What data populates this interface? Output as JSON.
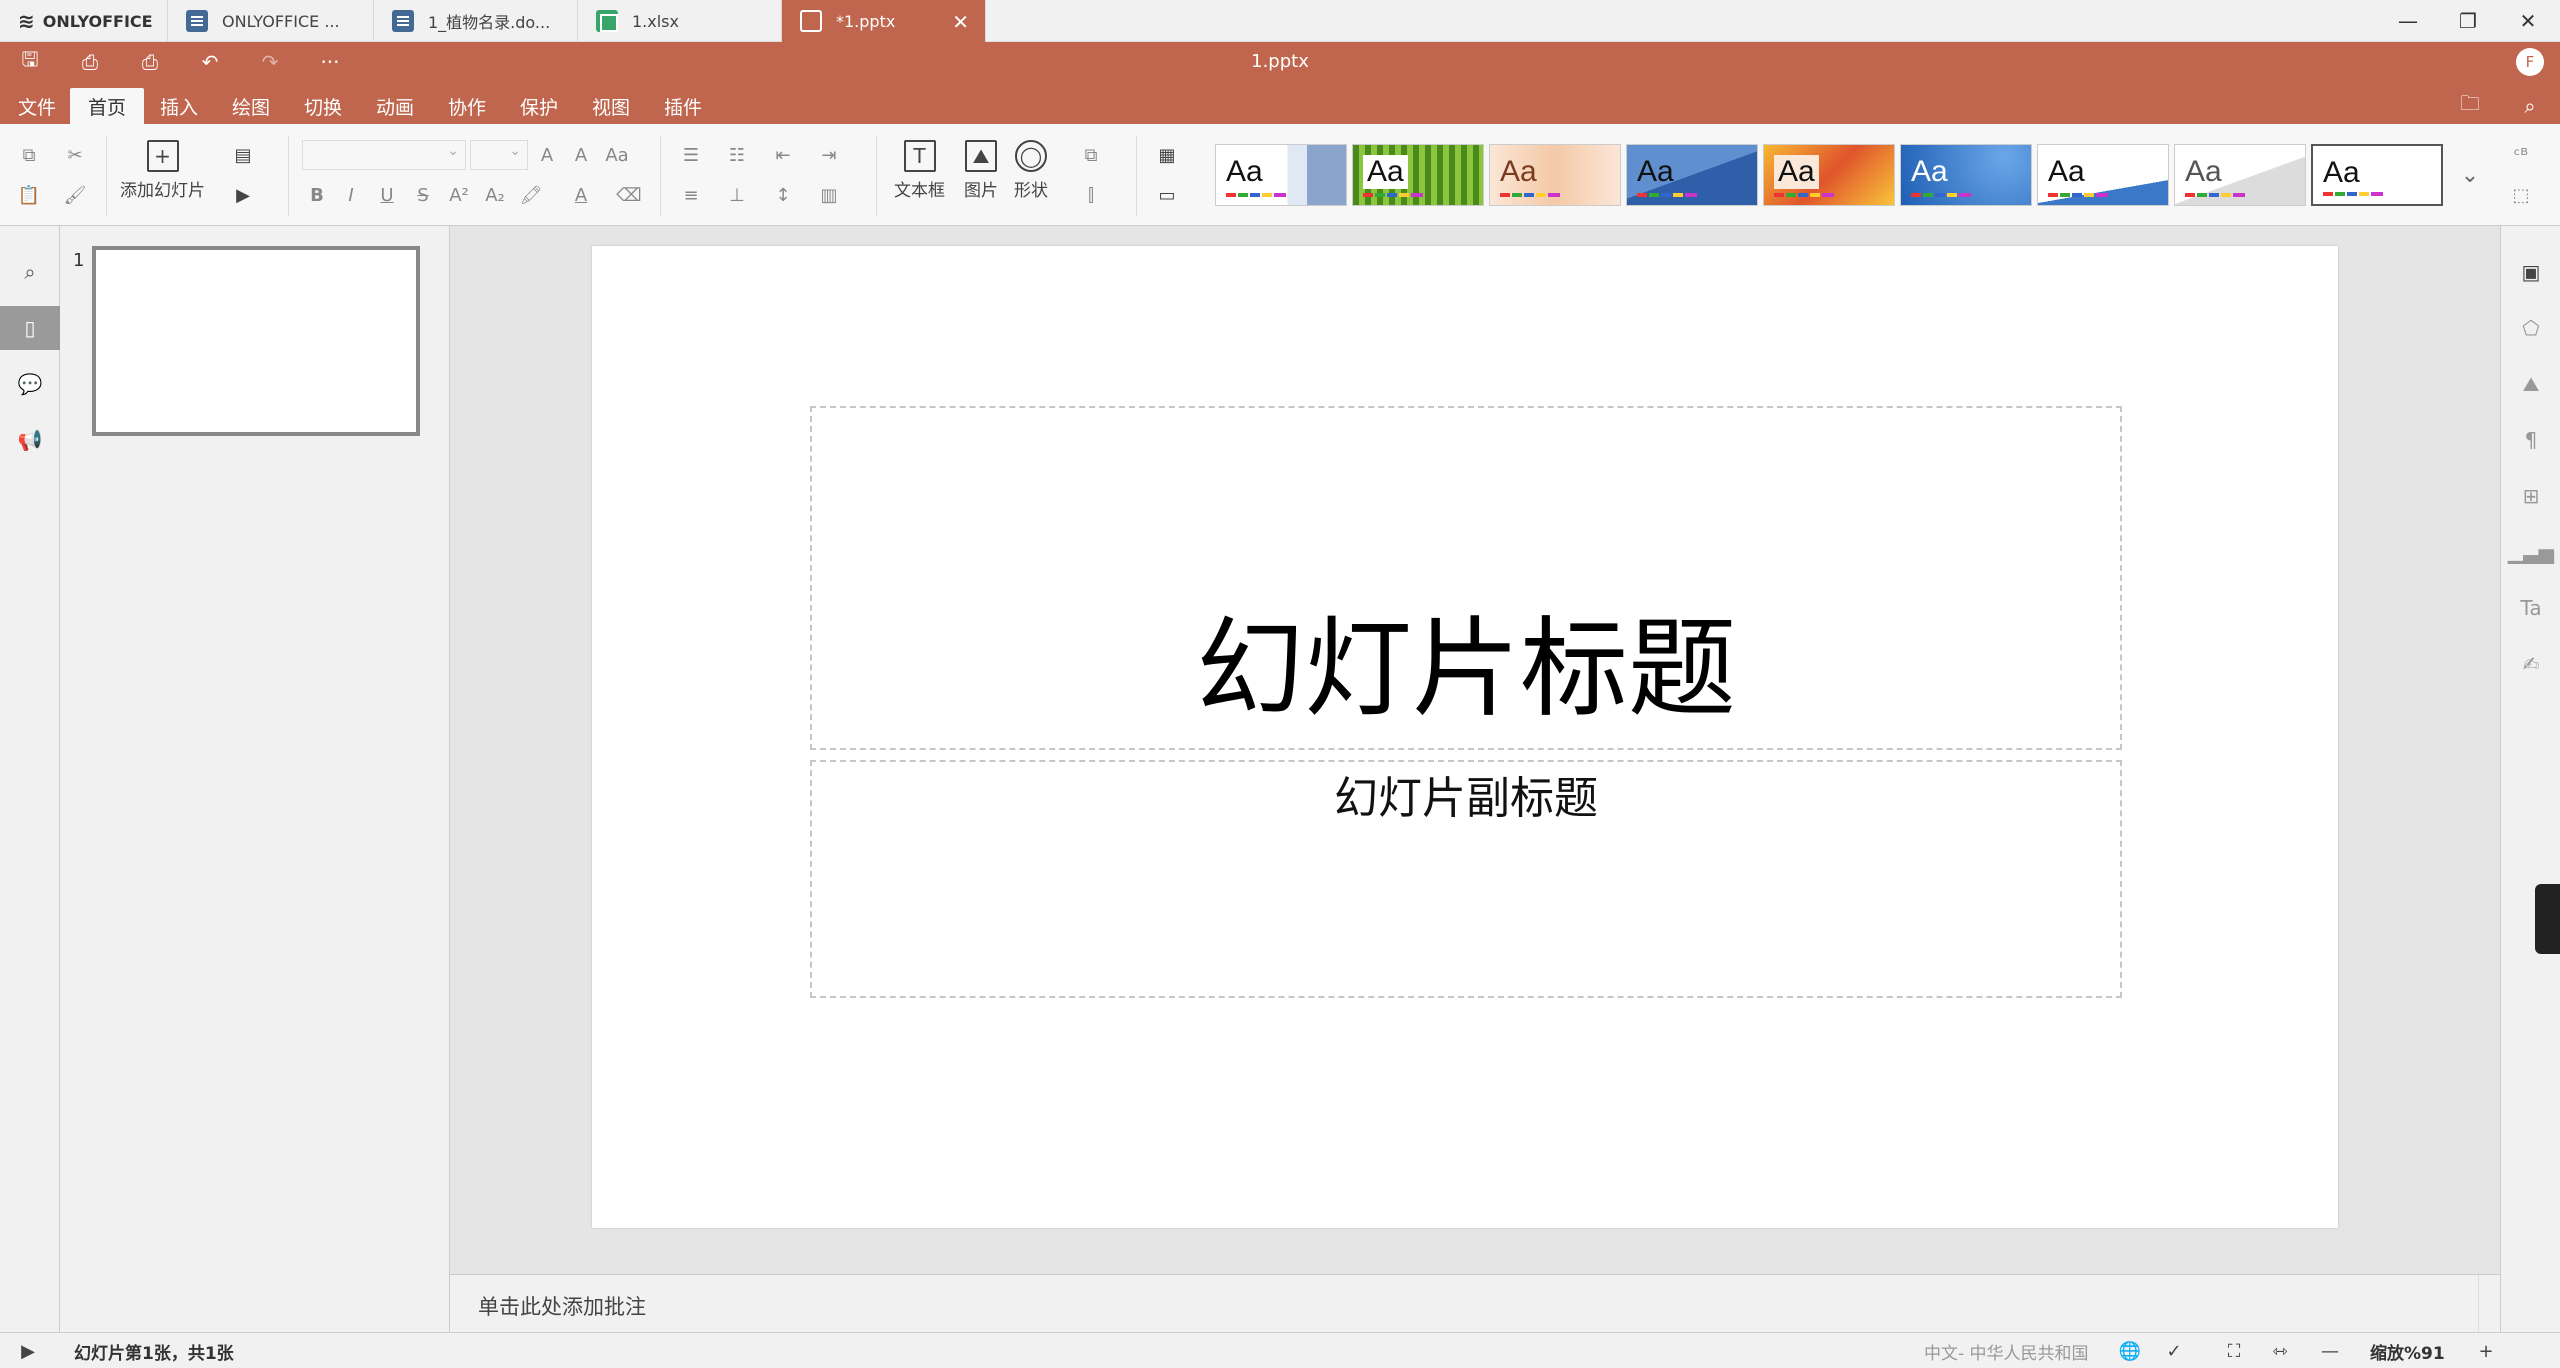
{
  "window_tabs": [
    {
      "label": "ONLYOFFICE",
      "icon": "onlyoffice-logo-icon"
    },
    {
      "label": "ONLYOFFICE ...",
      "icon": "document-icon"
    },
    {
      "label": "1_植物名录.do...",
      "icon": "document-icon"
    },
    {
      "label": "1.xlsx",
      "icon": "spreadsheet-icon"
    },
    {
      "label": "*1.pptx",
      "icon": "presentation-icon",
      "active": true
    }
  ],
  "header": {
    "title": "1.pptx",
    "user_initial": "F",
    "more": "···"
  },
  "menu_tabs": [
    "文件",
    "首页",
    "插入",
    "绘图",
    "切换",
    "动画",
    "协作",
    "保护",
    "视图",
    "插件"
  ],
  "toolbar": {
    "add_slide": "添加幻灯片",
    "text_box": "文本框",
    "image": "图片",
    "shape": "形状",
    "theme_sample": "Aa"
  },
  "slide_panel": {
    "thumbnail_number": "1"
  },
  "slide": {
    "title": "幻灯片标题",
    "subtitle": "幻灯片副标题"
  },
  "notes": {
    "placeholder": "单击此处添加批注"
  },
  "status": {
    "slide_info": "幻灯片第1张，共1张",
    "language": "中文- 中华人民共和国",
    "zoom": "缩放%91"
  },
  "colors": {
    "accent": "#c0664e",
    "toolbar_bg": "#f7f7f7",
    "panel_bg": "#f1f1f1",
    "canvas_bg": "#e5e5e5"
  }
}
